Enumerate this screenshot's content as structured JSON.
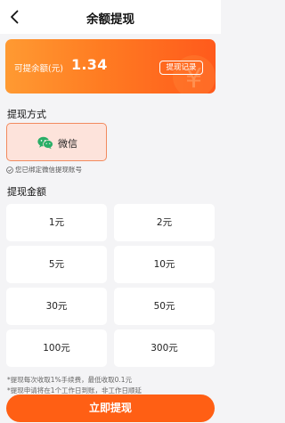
{
  "header": {
    "title": "余额提现"
  },
  "balance": {
    "label": "可提余额(元)",
    "amount": "1.34",
    "record_label": "提现记录"
  },
  "method_section": {
    "title": "提现方式",
    "selected_method": "微信",
    "bind_tip": "您已绑定微信提现账号"
  },
  "amount_section": {
    "title": "提现金额",
    "options": [
      "1元",
      "2元",
      "5元",
      "10元",
      "30元",
      "50元",
      "100元",
      "300元"
    ]
  },
  "notes": [
    "*提现每次收取1%手续费，最低收取0.1元",
    "*提现申请将在1个工作日到账，非工作日顺延"
  ],
  "submit_label": "立即提现",
  "colors": {
    "accent": "#ff5f14",
    "card_gradient_start": "#ff9a32",
    "card_gradient_end": "#ff5a1c",
    "wechat_green": "#2aae67"
  }
}
